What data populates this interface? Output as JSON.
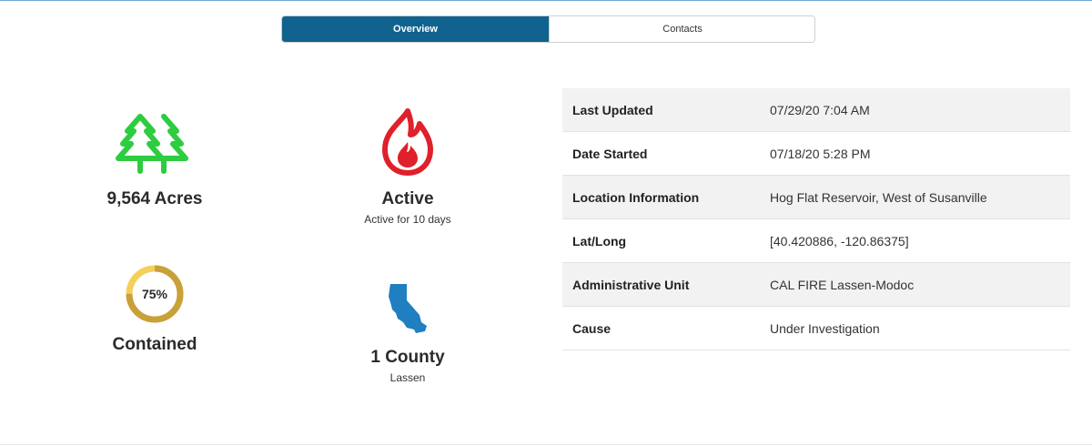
{
  "tabs": [
    {
      "label": "Overview",
      "active": true
    },
    {
      "label": "Contacts",
      "active": false
    }
  ],
  "stats": {
    "acres": {
      "value": "9,564 Acres",
      "icon": "trees-icon",
      "color": "#2ecc40"
    },
    "status": {
      "value": "Active",
      "sub": "Active for 10 days",
      "icon": "fire-icon",
      "color": "#e0202a"
    },
    "containment": {
      "percent_label": "75%",
      "percent": 75,
      "value": "Contained",
      "ring_color": "#c9a13a",
      "ring_track_color": "#f6cf5a"
    },
    "county": {
      "value": "1 County",
      "sub": "Lassen",
      "icon": "california-map-icon",
      "color": "#1f7fc0"
    }
  },
  "details": [
    {
      "label": "Last Updated",
      "value": "07/29/20 7:04 AM"
    },
    {
      "label": "Date Started",
      "value": "07/18/20 5:28 PM"
    },
    {
      "label": "Location Information",
      "value": "Hog Flat Reservoir, West of Susanville"
    },
    {
      "label": "Lat/Long",
      "value": "[40.420886, -120.86375]"
    },
    {
      "label": "Administrative Unit",
      "value": "CAL FIRE Lassen-Modoc"
    },
    {
      "label": "Cause",
      "value": "Under Investigation"
    }
  ]
}
